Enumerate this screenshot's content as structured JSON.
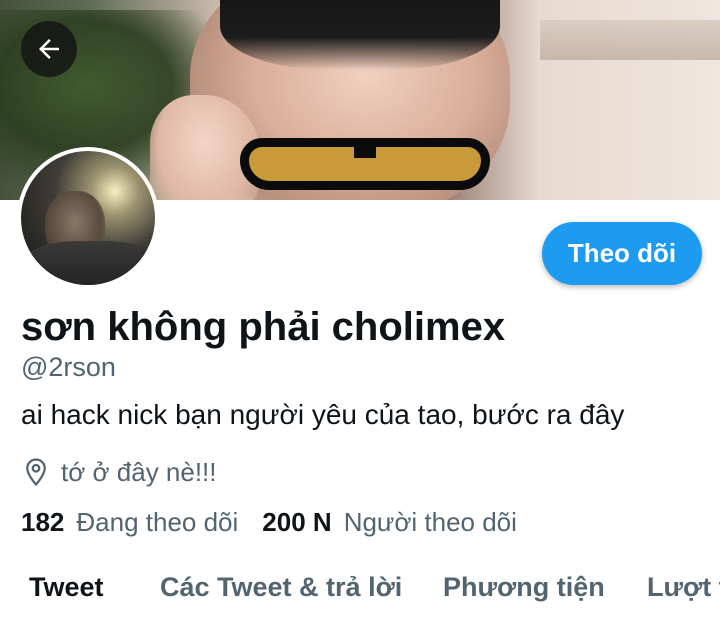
{
  "profile": {
    "display_name": "sơn không phải cholimex",
    "handle": "@2rson",
    "bio": "ai hack nick bạn người yêu của tao, bước ra đây",
    "location": "tớ ở đây nè!!!",
    "follow_button_label": "Theo dõi"
  },
  "stats": {
    "following_count": "182",
    "following_label": "Đang theo dõi",
    "followers_count": "200 N",
    "followers_label": "Người theo dõi"
  },
  "tabs": [
    {
      "label": "Tweet",
      "active": true
    },
    {
      "label": "Các Tweet & trả lời",
      "active": false
    },
    {
      "label": "Phương tiện",
      "active": false
    },
    {
      "label": "Lượt thích",
      "active": false
    }
  ],
  "icons": {
    "back": "arrow-left-icon",
    "location": "location-pin-icon"
  },
  "colors": {
    "accent": "#1d9bf0",
    "primary_text": "#0f1419",
    "secondary_text": "#536471"
  }
}
